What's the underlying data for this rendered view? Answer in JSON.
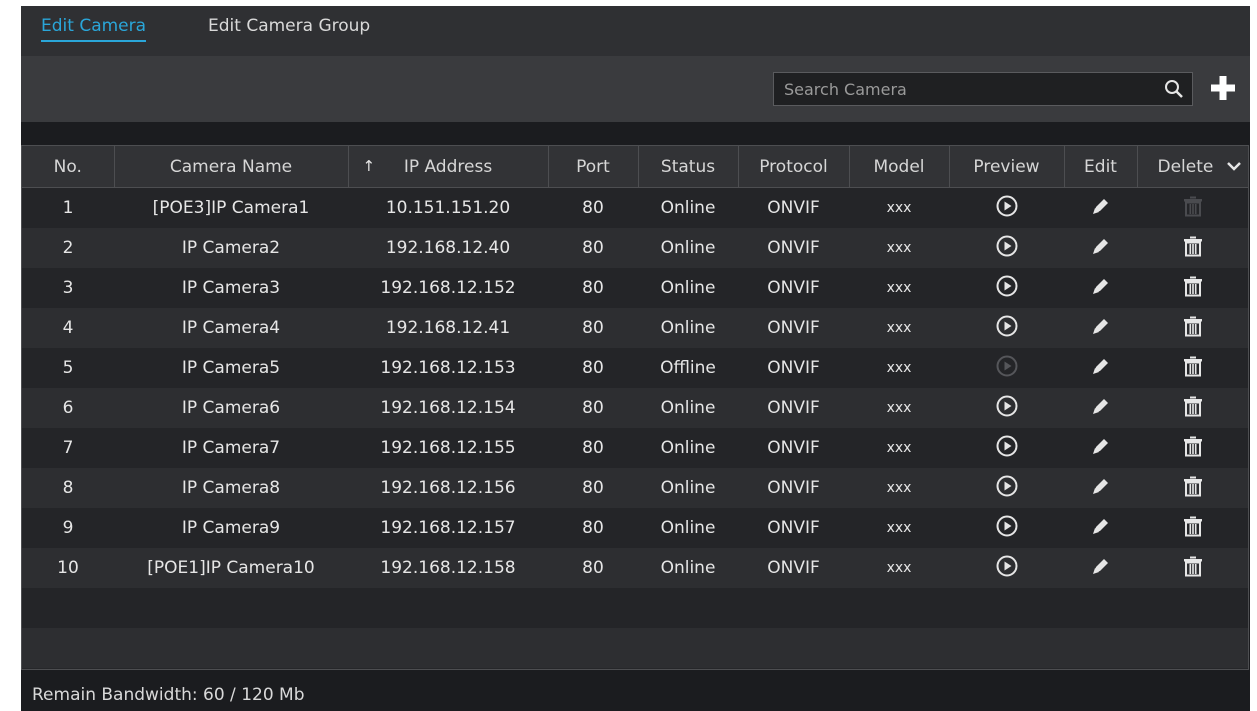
{
  "tabs": [
    {
      "label": "Edit Camera",
      "active": true
    },
    {
      "label": "Edit Camera Group",
      "active": false
    }
  ],
  "search": {
    "placeholder": "Search Camera",
    "value": ""
  },
  "icons": {
    "search": "search-icon",
    "add": "plus-icon",
    "preview": "play-circle-icon",
    "edit": "pencil-icon",
    "delete": "trash-icon",
    "sort": "arrow-up-icon",
    "menu": "chevron-down-icon"
  },
  "colors": {
    "accent": "#2aa6d9",
    "background": "#1b1c1f",
    "header": "#323336"
  },
  "table": {
    "columns": [
      "No.",
      "Camera Name",
      "IP Address",
      "Port",
      "Status",
      "Protocol",
      "Model",
      "Preview",
      "Edit",
      "Delete"
    ],
    "sort_column": "IP Address",
    "rows": [
      {
        "no": "1",
        "name": "[POE3]IP Camera1",
        "ip": "10.151.151.20",
        "port": "80",
        "status": "Online",
        "protocol": "ONVIF",
        "model": "xxx",
        "preview_enabled": true,
        "delete_enabled": false
      },
      {
        "no": "2",
        "name": "IP Camera2",
        "ip": "192.168.12.40",
        "port": "80",
        "status": "Online",
        "protocol": "ONVIF",
        "model": "xxx",
        "preview_enabled": true,
        "delete_enabled": true
      },
      {
        "no": "3",
        "name": "IP Camera3",
        "ip": "192.168.12.152",
        "port": "80",
        "status": "Online",
        "protocol": "ONVIF",
        "model": "xxx",
        "preview_enabled": true,
        "delete_enabled": true
      },
      {
        "no": "4",
        "name": "IP Camera4",
        "ip": "192.168.12.41",
        "port": "80",
        "status": "Online",
        "protocol": "ONVIF",
        "model": "xxx",
        "preview_enabled": true,
        "delete_enabled": true
      },
      {
        "no": "5",
        "name": "IP Camera5",
        "ip": "192.168.12.153",
        "port": "80",
        "status": "Offline",
        "protocol": "ONVIF",
        "model": "xxx",
        "preview_enabled": false,
        "delete_enabled": true
      },
      {
        "no": "6",
        "name": "IP Camera6",
        "ip": "192.168.12.154",
        "port": "80",
        "status": "Online",
        "protocol": "ONVIF",
        "model": "xxx",
        "preview_enabled": true,
        "delete_enabled": true
      },
      {
        "no": "7",
        "name": "IP Camera7",
        "ip": "192.168.12.155",
        "port": "80",
        "status": "Online",
        "protocol": "ONVIF",
        "model": "xxx",
        "preview_enabled": true,
        "delete_enabled": true
      },
      {
        "no": "8",
        "name": "IP Camera8",
        "ip": "192.168.12.156",
        "port": "80",
        "status": "Online",
        "protocol": "ONVIF",
        "model": "xxx",
        "preview_enabled": true,
        "delete_enabled": true
      },
      {
        "no": "9",
        "name": "IP Camera9",
        "ip": "192.168.12.157",
        "port": "80",
        "status": "Online",
        "protocol": "ONVIF",
        "model": "xxx",
        "preview_enabled": true,
        "delete_enabled": true
      },
      {
        "no": "10",
        "name": "[POE1]IP Camera10",
        "ip": "192.168.12.158",
        "port": "80",
        "status": "Online",
        "protocol": "ONVIF",
        "model": "xxx",
        "preview_enabled": true,
        "delete_enabled": true
      }
    ]
  },
  "footer": {
    "bandwidth": "Remain Bandwidth: 60 / 120 Mb"
  }
}
